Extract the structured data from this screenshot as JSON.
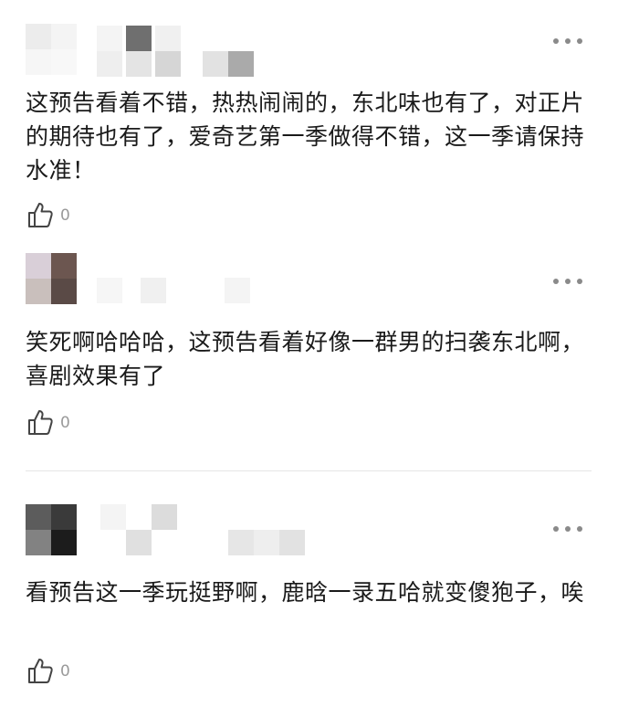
{
  "comments": [
    {
      "text": "这预告看着不错，热热闹闹的，东北味也有了，对正片的期待也有了，爱奇艺第一季做得不错，这一季请保持水准！",
      "like_count": "0",
      "avatar_colors": [
        "#ececec",
        "#f4f4f4",
        "#f6f6f6",
        "#f8f8f8"
      ]
    },
    {
      "text": "笑死啊哈哈哈，这预告看着好像一群男的扫袭东北啊，喜剧效果有了",
      "like_count": "0",
      "avatar_colors": [
        "#d9cfd8",
        "#6c5650",
        "#c9bfbc",
        "#5a4a46"
      ]
    },
    {
      "text": "看预告这一季玩挺野啊，鹿晗一录五哈就变傻狍子，唉",
      "like_count": "0",
      "avatar_colors": [
        "#5c5c5c",
        "#3a3a3a",
        "#828282",
        "#1c1c1c"
      ]
    }
  ],
  "icons": {
    "more": "more-dots-icon",
    "like": "thumbs-up-icon"
  },
  "colors": {
    "text": "#1a1a1a",
    "muted": "#9a9a9a",
    "divider": "#e6e6e6"
  }
}
